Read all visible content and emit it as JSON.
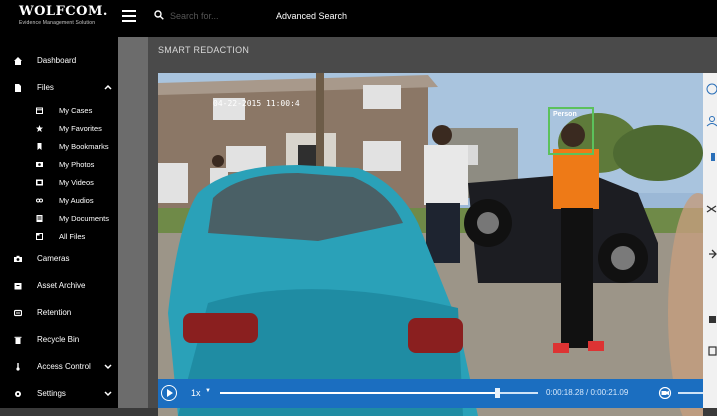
{
  "app": {
    "logo_text": "WOLFCOM.",
    "logo_tagline": "Evidence Management Solution"
  },
  "search": {
    "placeholder": "Search for...",
    "advanced_label": "Advanced Search"
  },
  "sidebar": {
    "items": [
      {
        "label": "Dashboard",
        "icon": "home-icon"
      },
      {
        "label": "Files",
        "icon": "file-icon",
        "expanded": true
      },
      {
        "label": "Cameras",
        "icon": "camera-icon"
      },
      {
        "label": "Asset Archive",
        "icon": "archive-icon"
      },
      {
        "label": "Retention",
        "icon": "retention-icon"
      },
      {
        "label": "Recycle Bin",
        "icon": "trash-icon"
      },
      {
        "label": "Access Control",
        "icon": "key-icon"
      },
      {
        "label": "Settings",
        "icon": "gear-icon"
      }
    ],
    "files_sub": [
      {
        "label": "My Cases",
        "icon": "calendar-icon"
      },
      {
        "label": "My Favorites",
        "icon": "star-icon"
      },
      {
        "label": "My Bookmarks",
        "icon": "bookmark-icon"
      },
      {
        "label": "My Photos",
        "icon": "photo-icon"
      },
      {
        "label": "My Videos",
        "icon": "video-icon"
      },
      {
        "label": "My Audios",
        "icon": "audio-icon"
      },
      {
        "label": "My Documents",
        "icon": "document-icon"
      },
      {
        "label": "All Files",
        "icon": "folder-icon"
      }
    ]
  },
  "page": {
    "title": "SMART REDACTION"
  },
  "video": {
    "overlay_timestamp": "04-22-2015 11:00:4",
    "detection_label": "Person",
    "detection_color": "#5cc15c"
  },
  "player": {
    "speed": "1x",
    "progress": 0.87,
    "timecode": "0:00:18.28 / 0:00:21.09",
    "accent": "#1b6ec0"
  }
}
